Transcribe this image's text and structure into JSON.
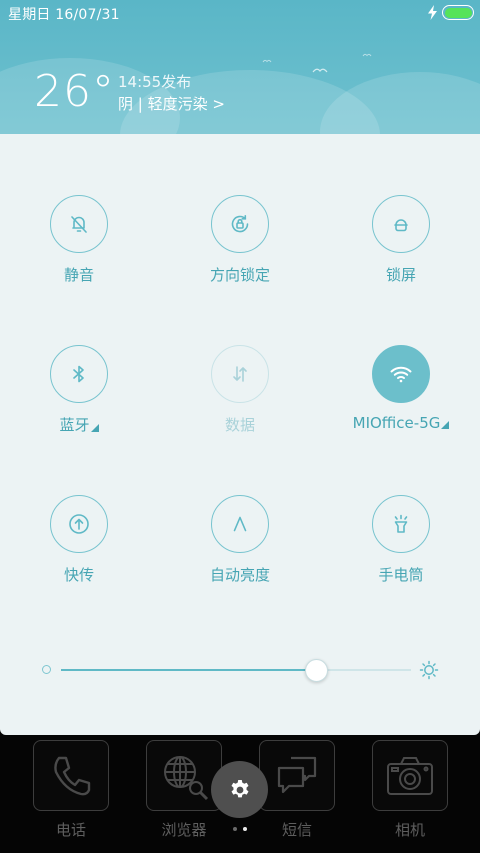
{
  "status_bar": {
    "datetime": "星期日 16/07/31",
    "charging_icon": "lightning-icon",
    "battery_icon": "battery-icon",
    "battery_color": "#56e35a"
  },
  "weather": {
    "temperature": "26°",
    "publish_time": "14:55发布",
    "condition": "阴 | 轻度污染 >"
  },
  "toggles": [
    {
      "label": "静音",
      "icon": "bell-off-icon",
      "state": "off"
    },
    {
      "label": "方向锁定",
      "icon": "rotation-lock-icon",
      "state": "off"
    },
    {
      "label": "锁屏",
      "icon": "lock-icon",
      "state": "off"
    },
    {
      "label": "蓝牙",
      "icon": "bluetooth-icon",
      "state": "off",
      "has_menu": true
    },
    {
      "label": "数据",
      "icon": "mobile-data-icon",
      "state": "disabled"
    },
    {
      "label": "MIOffice-5G",
      "icon": "wifi-icon",
      "state": "on",
      "has_menu": true
    },
    {
      "label": "快传",
      "icon": "transfer-icon",
      "state": "off"
    },
    {
      "label": "自动亮度",
      "icon": "auto-brightness-icon",
      "state": "off"
    },
    {
      "label": "手电筒",
      "icon": "flashlight-icon",
      "state": "off"
    }
  ],
  "brightness": {
    "level": 0.73,
    "min_icon": "brightness-low-icon",
    "max_icon": "sun-icon"
  },
  "dock": [
    {
      "label": "电话",
      "icon": "phone-icon"
    },
    {
      "label": "浏览器",
      "icon": "globe-icon"
    },
    {
      "label": "短信",
      "icon": "message-icon"
    },
    {
      "label": "相机",
      "icon": "camera-icon"
    }
  ],
  "settings_icon": "gear-icon",
  "pages": {
    "count": 2,
    "active": 1
  },
  "colors": {
    "accent": "#46a5b3",
    "header": "#5ab6c7",
    "panel": "#ecf3f4"
  }
}
